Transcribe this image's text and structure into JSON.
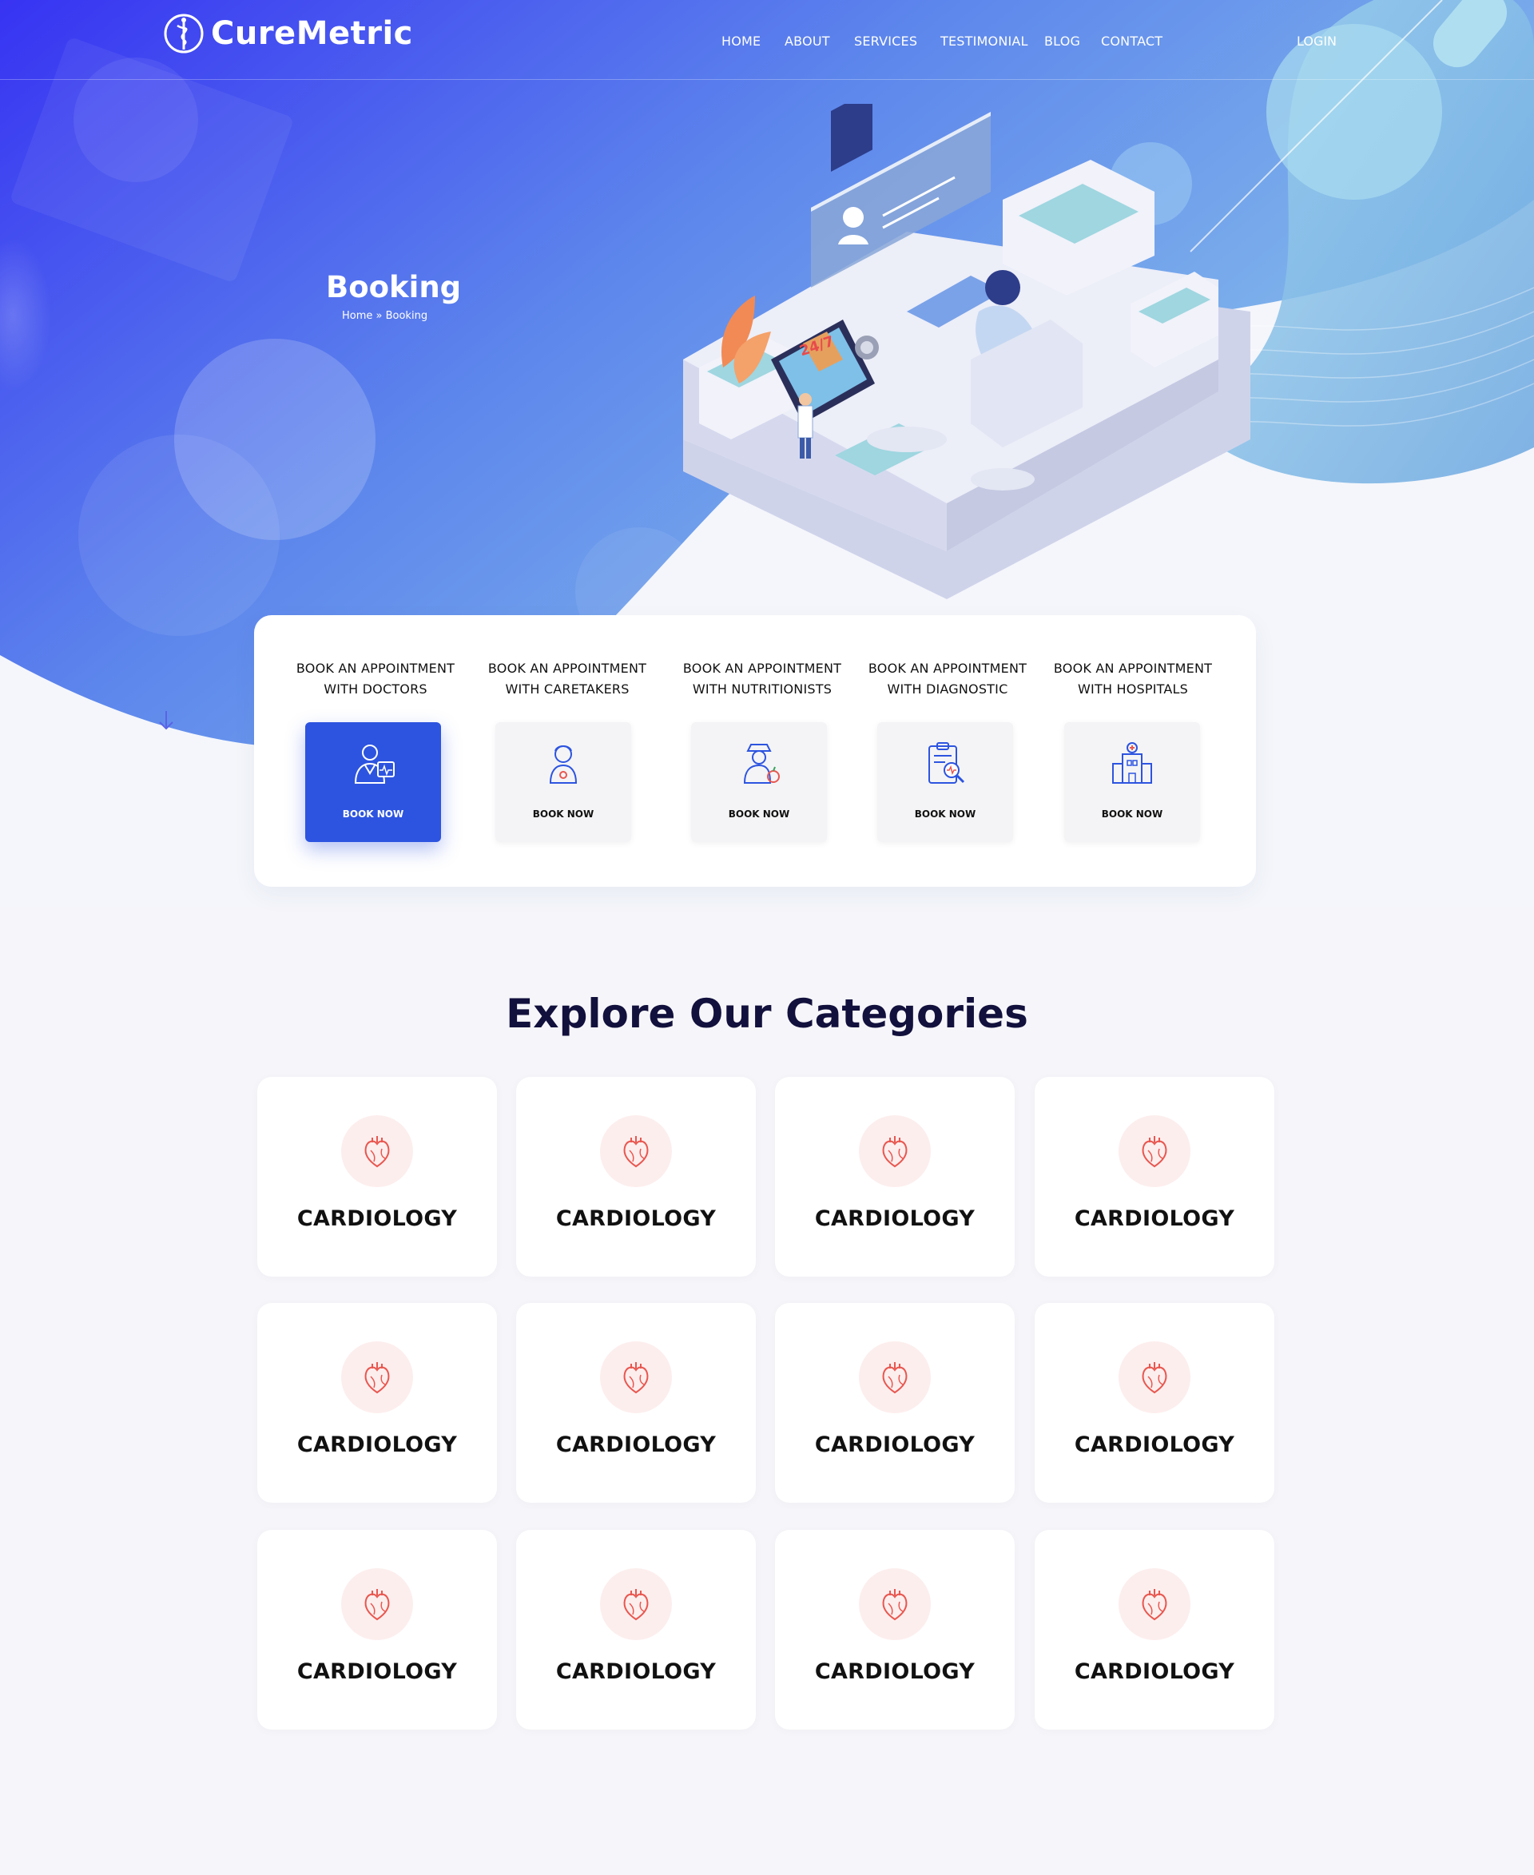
{
  "brand": {
    "name": "CureMetric"
  },
  "nav": {
    "home": "HOME",
    "about": "ABOUT",
    "services": "SERVICES",
    "testimonial": "TESTIMONIAL",
    "blog": "BLOG",
    "contact": "CONTACT",
    "login": "LOGIN"
  },
  "hero": {
    "title": "Booking",
    "breadcrumb": "Home » Booking",
    "badge": "24/7"
  },
  "booking": {
    "button_label": "BOOK NOW",
    "items": [
      {
        "line1": "BOOK AN APPOINTMENT",
        "line2": "WITH DOCTORS",
        "icon": "doctor-icon",
        "active": true
      },
      {
        "line1": "BOOK AN APPOINTMENT",
        "line2": "WITH  CARETAKERS",
        "icon": "caretaker-icon",
        "active": false
      },
      {
        "line1": "BOOK AN APPOINTMENT",
        "line2": "WITH  NUTRITIONISTS",
        "icon": "nutritionist-icon",
        "active": false
      },
      {
        "line1": "BOOK AN APPOINTMENT",
        "line2": "WITH  DIAGNOSTIC",
        "icon": "diagnostic-icon",
        "active": false
      },
      {
        "line1": "BOOK AN APPOINTMENT",
        "line2": "WITH  HOSPITALS",
        "icon": "hospital-icon",
        "active": false
      }
    ]
  },
  "categories": {
    "title": "Explore Our Categories",
    "items": [
      {
        "label": "CARDIOLOGY",
        "icon": "heart-icon"
      },
      {
        "label": "CARDIOLOGY",
        "icon": "heart-icon"
      },
      {
        "label": "CARDIOLOGY",
        "icon": "heart-icon"
      },
      {
        "label": "CARDIOLOGY",
        "icon": "heart-icon"
      },
      {
        "label": "CARDIOLOGY",
        "icon": "heart-icon"
      },
      {
        "label": "CARDIOLOGY",
        "icon": "heart-icon"
      },
      {
        "label": "CARDIOLOGY",
        "icon": "heart-icon"
      },
      {
        "label": "CARDIOLOGY",
        "icon": "heart-icon"
      },
      {
        "label": "CARDIOLOGY",
        "icon": "heart-icon"
      },
      {
        "label": "CARDIOLOGY",
        "icon": "heart-icon"
      },
      {
        "label": "CARDIOLOGY",
        "icon": "heart-icon"
      },
      {
        "label": "CARDIOLOGY",
        "icon": "heart-icon"
      }
    ]
  },
  "colors": {
    "primary": "#2d54e0",
    "hero_start": "#3a36f0",
    "hero_end": "#7fb6ec",
    "heading": "#12103c",
    "icon_bg": "#fdeeee",
    "icon_stroke": "#e8574f"
  }
}
